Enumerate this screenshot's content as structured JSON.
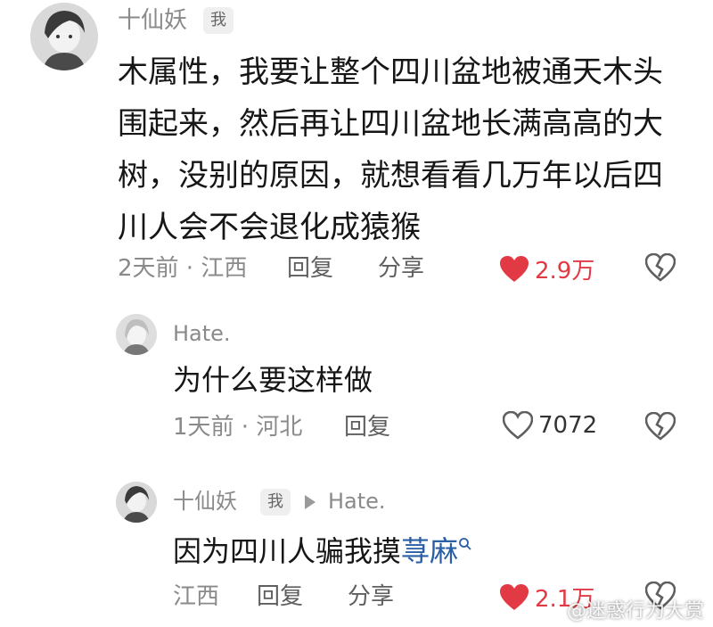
{
  "colors": {
    "like_active": "#e23a45",
    "link": "#2a5fa5",
    "muted": "#8a8a8a"
  },
  "comment1": {
    "username": "十仙妖",
    "author_tag": "我",
    "lines": [
      "木属性，我要让整个四川盆地被通天木头",
      "围起来，然后再让四川盆地长满高高的大",
      "树，没别的原因，就想看看几万年以后四",
      "川人会不会退化成猿猴"
    ],
    "meta": "2天前 · 江西",
    "reply_label": "回复",
    "share_label": "分享",
    "likes": "2.9万",
    "liked": true
  },
  "reply1": {
    "username": "Hate.",
    "text": "为什么要这样做",
    "meta": "1天前 · 河北",
    "reply_label": "回复",
    "likes": "7072",
    "liked": false
  },
  "reply2": {
    "username": "十仙妖",
    "author_tag": "我",
    "reply_to": "Hate.",
    "text_prefix": "因为四川人骗我摸",
    "text_link": "荨麻",
    "meta": "江西",
    "reply_label": "回复",
    "share_label": "分享",
    "likes": "2.1万",
    "liked": true
  },
  "watermark": "@迷惑行为大赏",
  "icons": [
    "avatar",
    "heart-icon",
    "broken-heart-icon",
    "search-icon",
    "play-arrow-icon"
  ]
}
